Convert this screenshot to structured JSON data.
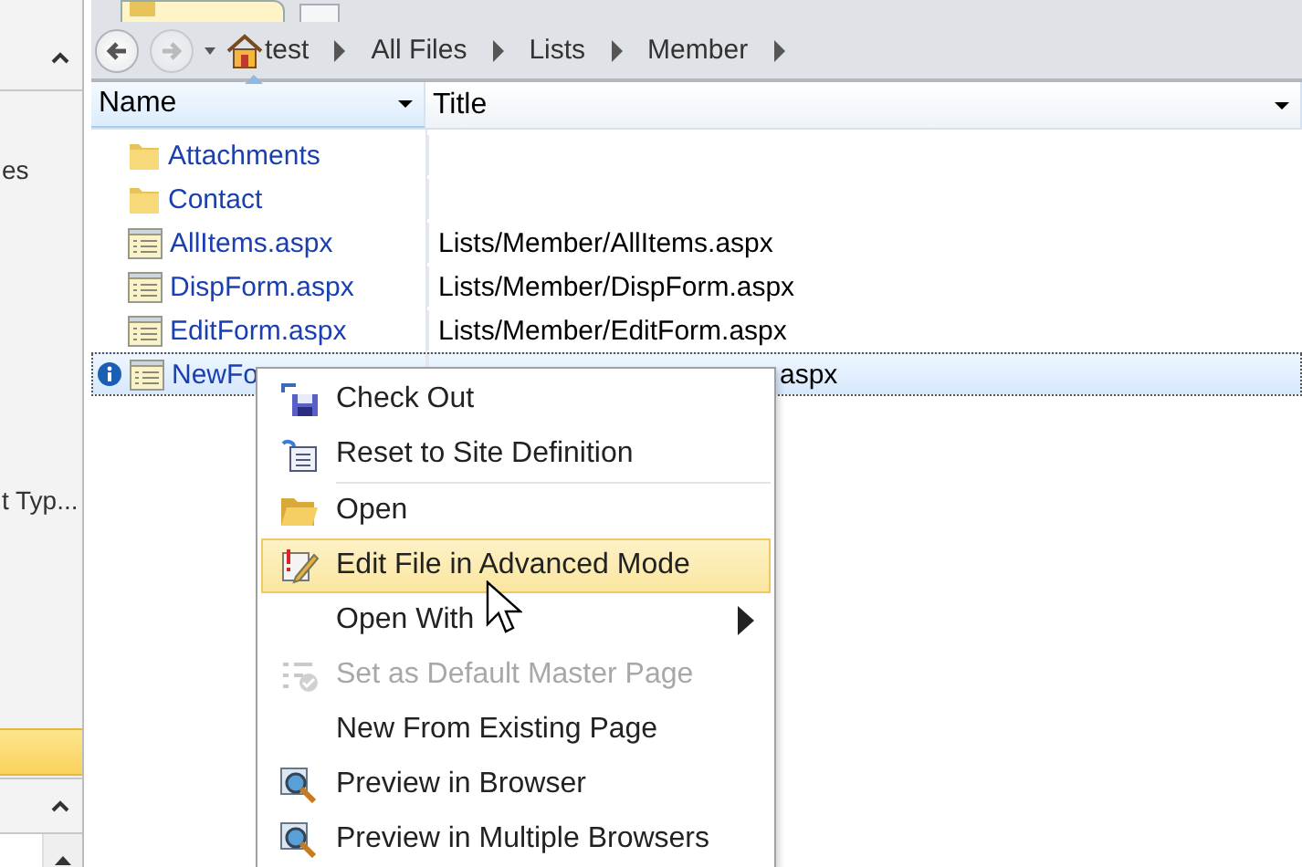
{
  "left_pane": {
    "items": [
      {
        "label": "es",
        "selected": false
      },
      {
        "label": "t Typ...",
        "selected": false
      },
      {
        "selected": true
      }
    ]
  },
  "breadcrumb": [
    "test",
    "All Files",
    "Lists",
    "Member"
  ],
  "columns": [
    {
      "label": "Name",
      "sorted": true
    },
    {
      "label": "Title",
      "sorted": false
    }
  ],
  "rows": [
    {
      "kind": "folder",
      "name": "Attachments",
      "selected": false
    },
    {
      "kind": "folder",
      "name": "Contact",
      "selected": false
    },
    {
      "kind": "page",
      "name": "AllItems.aspx",
      "title": "Lists/Member/AllItems.aspx",
      "selected": false
    },
    {
      "kind": "page",
      "name": "DispForm.aspx",
      "title": "Lists/Member/DispForm.aspx",
      "selected": false
    },
    {
      "kind": "page",
      "name": "EditForm.aspx",
      "title": "Lists/Member/EditForm.aspx",
      "selected": false
    },
    {
      "kind": "page",
      "name": "NewFo",
      "title": "aspx",
      "selected": true,
      "info": true
    }
  ],
  "context_menu": [
    {
      "label": "Check Out",
      "kind": "checkout",
      "selected": false,
      "disabled": false
    },
    {
      "label": "Reset to Site Definition",
      "kind": "reset",
      "selected": false,
      "disabled": false
    },
    {
      "kind": "separator"
    },
    {
      "label": "Open",
      "kind": "folder",
      "selected": false,
      "disabled": false
    },
    {
      "label": "Edit File in Advanced Mode",
      "kind": "edit",
      "selected": true,
      "disabled": false
    },
    {
      "label": "Open With",
      "kind": "plain",
      "selected": false,
      "disabled": false,
      "submenu": true
    },
    {
      "label": "Set as Default Master Page",
      "kind": "master",
      "selected": false,
      "disabled": true
    },
    {
      "label": "New From Existing Page",
      "kind": "plain",
      "selected": false,
      "disabled": false
    },
    {
      "label": "Preview in Browser",
      "kind": "preview",
      "selected": false,
      "disabled": false
    },
    {
      "label": "Preview in Multiple Browsers",
      "kind": "preview",
      "selected": false,
      "disabled": false
    }
  ]
}
